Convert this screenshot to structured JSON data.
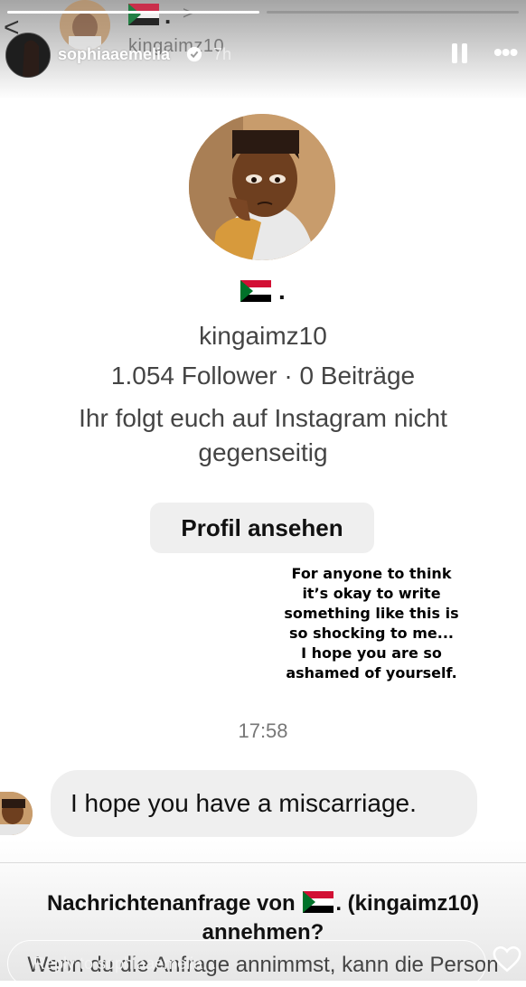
{
  "story": {
    "username": "sophiaaemelia",
    "time": "7h",
    "reply_placeholder": "Reply to sophiaaemelia..."
  },
  "chat_header": {
    "dot": ".",
    "username": "kingaimz10"
  },
  "profile": {
    "dot": ".",
    "username": "kingaimz10",
    "stats": "1.054 Follower · 0 Beiträge",
    "mutual": "Ihr folgt euch auf Instagram nicht gegenseitig",
    "view_button": "Profil ansehen"
  },
  "caption": {
    "lines": [
      "For anyone to think",
      "it’s okay to write",
      "something like this is",
      "so shocking to me...",
      "I hope you are so",
      "ashamed of yourself."
    ]
  },
  "messages": {
    "time": "17:58",
    "text": "I hope you have a miscarriage."
  },
  "request": {
    "title_line1_prefix": "Nachrichtenanfrage von",
    "title_line1_suffix": ". (kingaimz10)",
    "title_line2": "annehmen?",
    "body": "Wenn du die Anfrage annimmst, kann die Person"
  },
  "colors": {
    "bubble": "#efefef",
    "button": "#efefef",
    "text_gray": "#444444"
  },
  "icons": [
    "pause-icon",
    "more-icon",
    "verified-icon",
    "heart-icon",
    "back-arrow-icon",
    "sudan-flag-icon"
  ]
}
